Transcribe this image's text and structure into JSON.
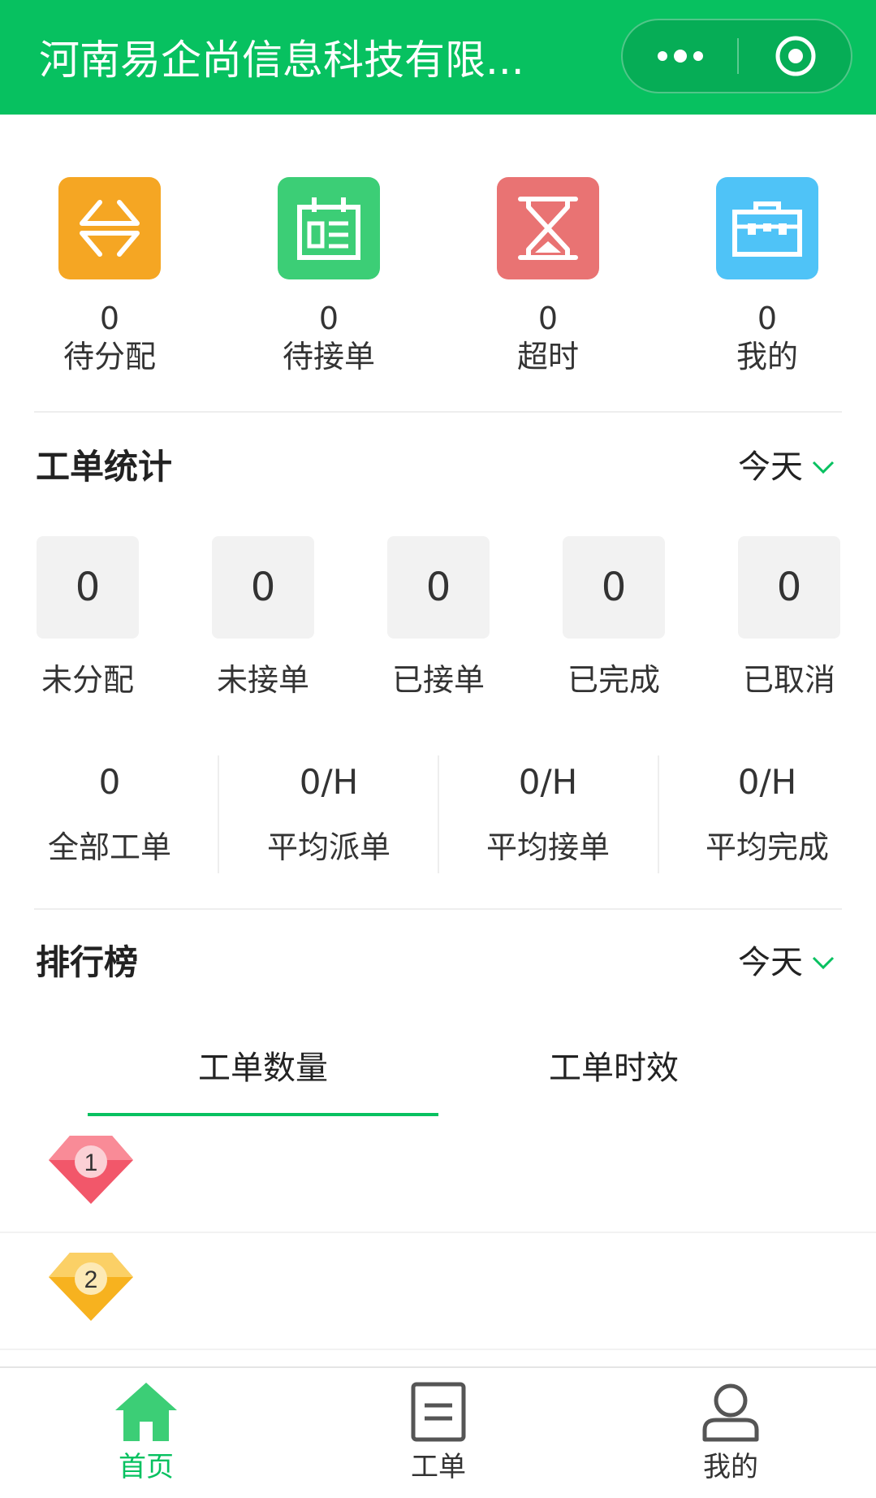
{
  "header": {
    "title": "河南易企尚信息科技有限...",
    "more_icon": "more-dots-icon",
    "close_icon": "target-icon"
  },
  "quick": [
    {
      "count": "0",
      "label": "待分配",
      "icon": "swap-arrows-icon",
      "color": "#f5a623"
    },
    {
      "count": "0",
      "label": "待接单",
      "icon": "calendar-icon",
      "color": "#3cce76"
    },
    {
      "count": "0",
      "label": "超时",
      "icon": "hourglass-icon",
      "color": "#e97373"
    },
    {
      "count": "0",
      "label": "我的",
      "icon": "toolbox-icon",
      "color": "#4fc3f7"
    }
  ],
  "stats": {
    "title": "工单统计",
    "filter": "今天",
    "items": [
      {
        "value": "0",
        "label": "未分配"
      },
      {
        "value": "0",
        "label": "未接单"
      },
      {
        "value": "0",
        "label": "已接单"
      },
      {
        "value": "0",
        "label": "已完成"
      },
      {
        "value": "0",
        "label": "已取消"
      }
    ]
  },
  "metrics": [
    {
      "value": "0",
      "label": "全部工单"
    },
    {
      "value": "0/H",
      "label": "平均派单"
    },
    {
      "value": "0/H",
      "label": "平均接单"
    },
    {
      "value": "0/H",
      "label": "平均完成"
    }
  ],
  "ranking": {
    "title": "排行榜",
    "filter": "今天",
    "tabs": [
      "工单数量",
      "工单时效"
    ],
    "active_tab": 0,
    "rows": [
      {
        "rank": "1",
        "color": "#f2576a"
      },
      {
        "rank": "2",
        "color": "#f7b21f"
      }
    ]
  },
  "tabbar": {
    "items": [
      {
        "label": "首页",
        "icon": "home-icon",
        "active": true
      },
      {
        "label": "工单",
        "icon": "document-icon",
        "active": false
      },
      {
        "label": "我的",
        "icon": "person-icon",
        "active": false
      }
    ]
  },
  "colors": {
    "brand": "#07c160",
    "text": "#333333",
    "box_bg": "#f2f2f2"
  }
}
